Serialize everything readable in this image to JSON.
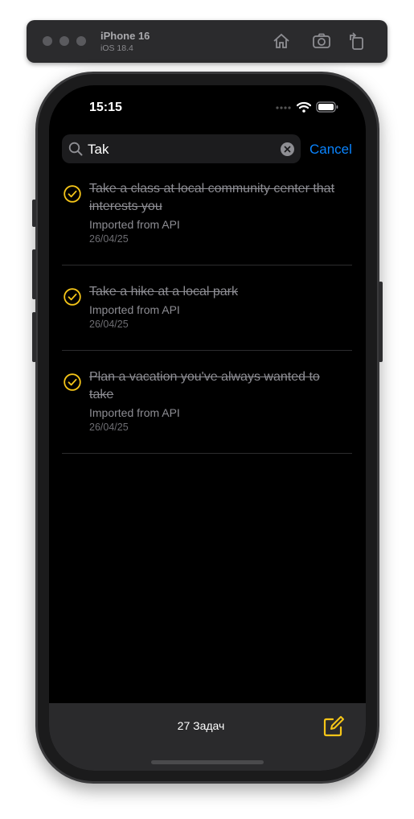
{
  "simulator": {
    "device": "iPhone 16",
    "os": "iOS 18.4",
    "buttons": [
      "home-icon",
      "screenshot-icon",
      "rotate-icon"
    ]
  },
  "status_bar": {
    "time": "15:15"
  },
  "search": {
    "query": "Tak",
    "cancel_label": "Cancel"
  },
  "tasks": [
    {
      "title": "Take a class at local community center that interests you",
      "note": "Imported from API",
      "date": "26/04/25",
      "completed": true
    },
    {
      "title": "Take a hike at a local park",
      "note": "Imported from API",
      "date": "26/04/25",
      "completed": true
    },
    {
      "title": "Plan a vacation you've always wanted to take",
      "note": "Imported from API",
      "date": "26/04/25",
      "completed": true
    }
  ],
  "toolbar": {
    "count_label": "27 Задач"
  },
  "colors": {
    "accent": "#f5c518",
    "link": "#0a84ff",
    "background": "#000000"
  }
}
